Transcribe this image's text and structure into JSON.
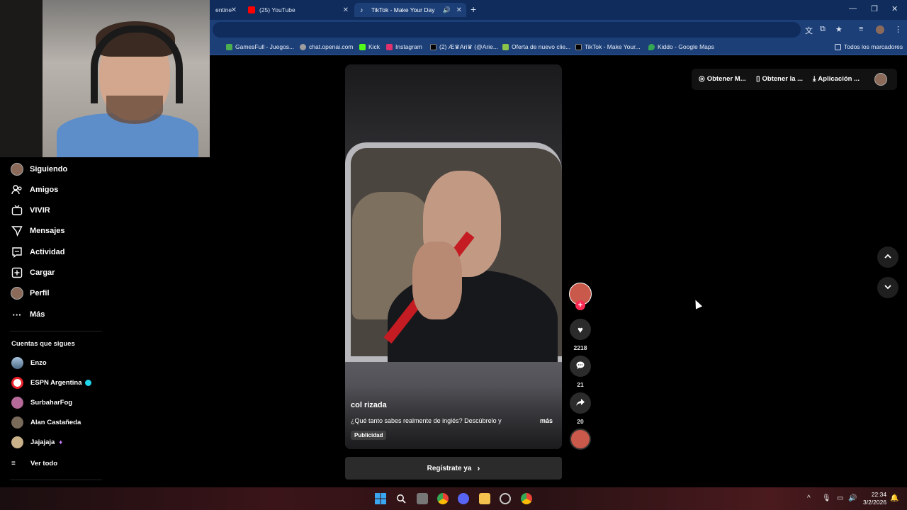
{
  "browser": {
    "tabs": [
      {
        "label": "entine"
      },
      {
        "label": "(25) YouTube"
      },
      {
        "label": "TikTok - Make Your Day"
      }
    ],
    "new_tab": "+",
    "window_controls": {
      "minimize": "—",
      "restore": "❐",
      "close": "✕"
    }
  },
  "bookmarks": [
    {
      "label": "GamesFull - Juegos...",
      "color": "#4caf50"
    },
    {
      "label": "chat.openai.com",
      "color": "#9e9e9e"
    },
    {
      "label": "Kick",
      "color": "#53fc18"
    },
    {
      "label": "Instagram",
      "color": "#e1306c"
    },
    {
      "label": "(2) Æ♛Ari♛ (@Arie...",
      "color": "#000000"
    },
    {
      "label": "Oferta de nuevo clie...",
      "color": "#8bc34a"
    },
    {
      "label": "TikTok - Make Your...",
      "color": "#000000"
    },
    {
      "label": "Kiddo - Google Maps",
      "color": "#34a853"
    },
    {
      "label": "Todos los marcadores",
      "color": "#dbe4f3"
    }
  ],
  "nav": {
    "items": [
      {
        "label": "Siguiendo",
        "icon": "avatar-icon"
      },
      {
        "label": "Amigos",
        "icon": "friends-icon"
      },
      {
        "label": "VIVIR",
        "icon": "live-icon"
      },
      {
        "label": "Mensajes",
        "icon": "messages-icon"
      },
      {
        "label": "Actividad",
        "icon": "activity-icon"
      },
      {
        "label": "Cargar",
        "icon": "upload-icon"
      },
      {
        "label": "Perfil",
        "icon": "profile-icon"
      },
      {
        "label": "Más",
        "icon": "more-icon"
      }
    ]
  },
  "following": {
    "title": "Cuentas que sigues",
    "accounts": [
      {
        "name": "Enzo",
        "color": "#6b8fb3"
      },
      {
        "name": "ESPN Argentina",
        "color": "#e8202a"
      },
      {
        "name": "SurbaharFog",
        "color": "#b56a9a"
      },
      {
        "name": "Alan Castañeda",
        "color": "#7a6a5a"
      },
      {
        "name": "Jajajaja",
        "color": "#c9b18a"
      }
    ],
    "see_all": "Ver todo"
  },
  "video": {
    "author": "col rizada",
    "description": "¿Qué tanto sabes realmente de inglés? Descúbrelo y",
    "more": "más",
    "ad_badge": "Publicidad",
    "cta": "Regístrate ya"
  },
  "actions": {
    "likes": "2218",
    "comments": "21",
    "shares": "20"
  },
  "header_right": {
    "item1": "Obtener M...",
    "item2": "Obtener la ...",
    "item3": "Aplicación ..."
  },
  "clock": {
    "time": "22:34",
    "date": "3/2/2026"
  },
  "colors": {
    "accent": "#fe2c55",
    "chrome_dark": "#0f2c5c",
    "chrome": "#1c3f78"
  }
}
